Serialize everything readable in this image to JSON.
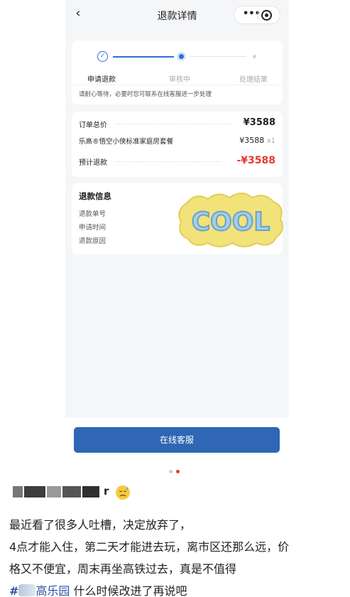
{
  "nav": {
    "back_icon": "chevron-left-icon",
    "title": "退款详情",
    "more_icon": "more-dots-icon",
    "close_icon": "target-circle-icon"
  },
  "progress": {
    "steps": [
      {
        "label": "申请退款",
        "state": "done"
      },
      {
        "label": "审核中",
        "state": "current"
      },
      {
        "label": "处理结果",
        "state": "pending"
      }
    ],
    "note": "请耐心等待，必要时您可联系在线客服进一步处理"
  },
  "order": {
    "total_label": "订单总价",
    "total_value": "¥3588",
    "item_name": "乐高®悟空小侠标准家庭房套餐",
    "item_price": "¥3588",
    "item_qty": "x1",
    "refund_label": "预计退款",
    "refund_value": "-¥3588"
  },
  "refund_info": {
    "title": "退款信息",
    "items": [
      "退款单号",
      "申请时间",
      "退款原因"
    ],
    "sticker_text": "COOL"
  },
  "service_button": "在线客服",
  "pager": {
    "count": 2,
    "active": 2
  },
  "post": {
    "name_tail": "r",
    "lines": [
      "最近看了很多人吐槽，决定放弃了，",
      "4点才能入住，第二天才能进去玩，离市区还那么远，价",
      "格又不便宜，周末再坐高铁过去，真是不值得"
    ],
    "hash": "#",
    "tag_text": "高乐园",
    "tail_text": " 什么时候改进了再说吧"
  },
  "colors": {
    "accent": "#2f6fd3",
    "button": "#2f66b5",
    "price_red": "#e8392f",
    "tag_blue": "#2f4fa6"
  }
}
